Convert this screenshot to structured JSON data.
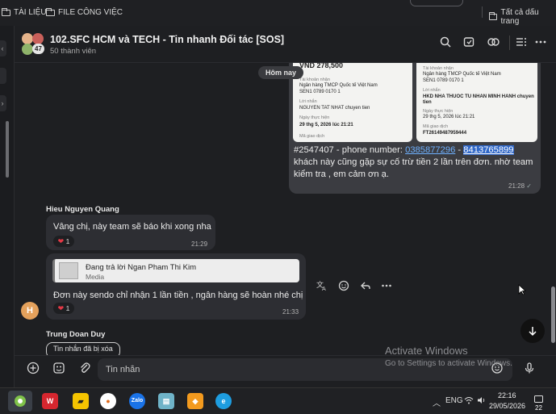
{
  "bookmarks": {
    "left1": "TÀI LIỆU",
    "left2": "FILE CÔNG VIỆC",
    "right": "Tất cả dấu trang"
  },
  "header": {
    "title": "102.SFC HCM và TECH - Tin nhanh Đối tác [SOS]",
    "members": "50 thành viên",
    "avatar_count": "47"
  },
  "chat": {
    "date_pill": "Hôm nay",
    "outgoing": {
      "receipt_left": {
        "amount": "VND 278,500",
        "acct_label": "Tài khoản nhận",
        "bank": "Ngân hàng TMCP Quốc tế Việt Nam",
        "acct_no": "SEN1 0789 0170 1",
        "to_label": "Lời nhắn",
        "to_val": "NGUYEN TAT NHAT chuyen tien",
        "date_label": "Ngày thực hiện",
        "date_val": "29 thg 5, 2026 lúc 21:21",
        "code_label": "Mã giao dịch"
      },
      "receipt_right": {
        "acct_label": "Tài khoản nhận",
        "bank": "Ngân hàng TMCP Quốc tế Việt Nam",
        "acct_no": "SEN1 0789 0170 1",
        "to_label": "Lời nhắn",
        "to_val": "HKD NHA THUOC TU NHAN MINH HANH chuyen tien",
        "date_label": "Ngày thực hiện",
        "date_val": "29 thg 5, 2026 lúc 21:21",
        "code_label": "Mã giao dịch",
        "code_val": "FT26149487959444"
      },
      "text_pre": "#2547407 - phone number: ",
      "phone1": "0385877296",
      "text_mid": " - ",
      "phone2": "8413765899",
      "text_post": " khách này cũng gặp sự cố trừ tiền 2 lần trên đơn. nhờ team  kiểm tra , em cảm ơn ạ.",
      "time": "21:28"
    },
    "msg1": {
      "sender": "Hieu Nguyen Quang",
      "text": "Vâng chị, này team sẽ báo khi xong nha",
      "reaction_count": "1",
      "time": "21:29"
    },
    "msg2": {
      "reply_title": "Đang trả lời Ngan Pham Thi Kim",
      "reply_sub": "Media",
      "text": "Đơn này sendo chỉ nhận 1 lần tiền , ngân hàng sẽ hoàn nhé chị",
      "reaction_count": "1",
      "time": "21:33",
      "avatar_letter": "H"
    },
    "msg3": {
      "sender": "Trung Doan Duy",
      "deleted": "Tin nhắn đã bị xóa"
    }
  },
  "watermark": {
    "title": "Activate Windows",
    "sub": "Go to Settings to activate Windows."
  },
  "input": {
    "placeholder": "Tin nhắn"
  },
  "taskbar": {
    "time": "22:16",
    "date": "29/05/2026",
    "notifications": "22"
  },
  "icons": {
    "header": [
      "search-icon",
      "video-call-icon",
      "mention-icon",
      "members-icon",
      "more-icon"
    ],
    "actions": [
      "translate-icon",
      "emoji-icon",
      "reply-icon",
      "more-icon"
    ],
    "input": [
      "add-icon",
      "sticker-icon",
      "attach-icon",
      "emoji-icon",
      "microphone-icon"
    ]
  }
}
